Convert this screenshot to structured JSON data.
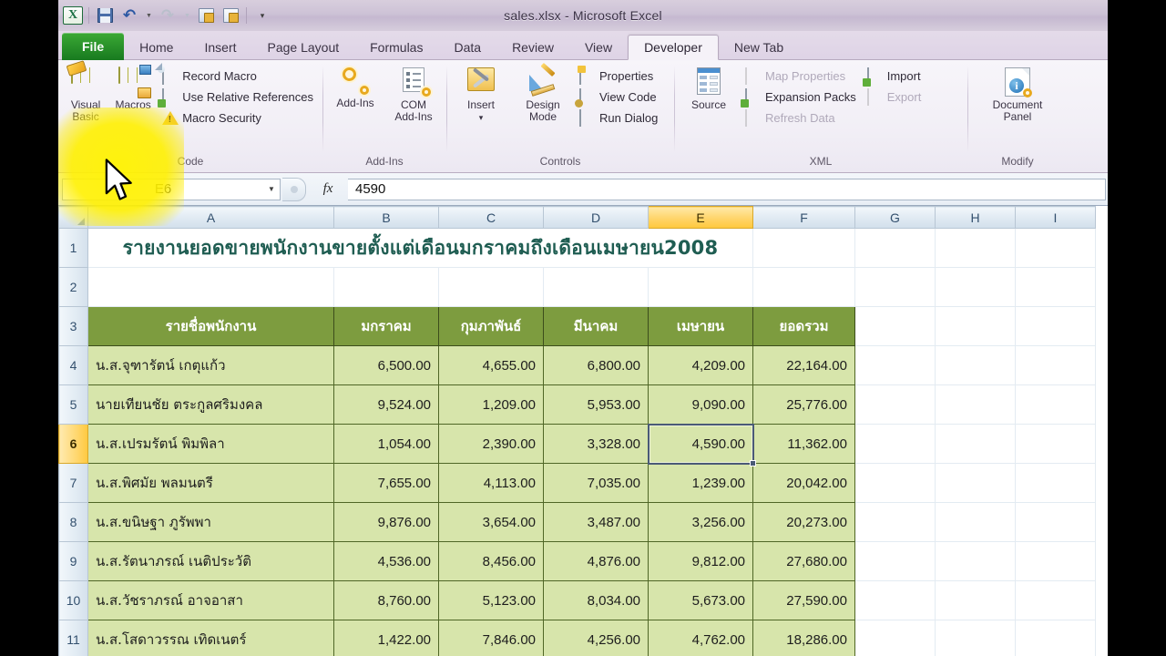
{
  "window": {
    "title": "sales.xlsx - Microsoft Excel"
  },
  "quick_access": {
    "items": [
      {
        "name": "excel-logo",
        "glyph": "X"
      },
      {
        "name": "save-button",
        "label": "Save"
      },
      {
        "name": "undo-button",
        "label": "Undo",
        "glyph": "↶"
      },
      {
        "name": "redo-button",
        "label": "Redo",
        "glyph": "↷"
      },
      {
        "name": "quick-print-button",
        "label": "Quick Print"
      },
      {
        "name": "print-preview-button",
        "label": "Print Preview"
      },
      {
        "name": "customize-qat-button",
        "label": "Customize Quick Access Toolbar",
        "glyph": "▾"
      }
    ]
  },
  "tabs": [
    {
      "label": "File",
      "active": false,
      "kind": "file"
    },
    {
      "label": "Home",
      "active": false
    },
    {
      "label": "Insert",
      "active": false
    },
    {
      "label": "Page Layout",
      "active": false
    },
    {
      "label": "Formulas",
      "active": false
    },
    {
      "label": "Data",
      "active": false
    },
    {
      "label": "Review",
      "active": false
    },
    {
      "label": "View",
      "active": false
    },
    {
      "label": "Developer",
      "active": true
    },
    {
      "label": "New Tab",
      "active": false
    }
  ],
  "ribbon": {
    "groups": [
      {
        "name": "Code",
        "big_buttons": [
          {
            "label": "Visual Basic",
            "line1": "Visual",
            "line2": "Basic",
            "icon": "visual-basic-icon"
          },
          {
            "label": "Macros",
            "line1": "Macros",
            "line2": "",
            "icon": "macros-icon"
          }
        ],
        "small_buttons": [
          {
            "label": "Record Macro",
            "icon": "record-macro-icon",
            "disabled": false
          },
          {
            "label": "Use Relative References",
            "icon": "relative-references-icon",
            "disabled": false
          },
          {
            "label": "Macro Security",
            "icon": "macro-security-icon",
            "disabled": false
          }
        ]
      },
      {
        "name": "Add-Ins",
        "big_buttons": [
          {
            "label": "Add-Ins",
            "line1": "Add-Ins",
            "line2": "",
            "icon": "add-ins-icon"
          },
          {
            "label": "COM Add-Ins",
            "line1": "COM",
            "line2": "Add-Ins",
            "icon": "com-add-ins-icon"
          }
        ],
        "small_buttons": []
      },
      {
        "name": "Controls",
        "big_buttons": [
          {
            "label": "Insert",
            "line1": "Insert",
            "line2": "▾",
            "icon": "insert-control-icon"
          },
          {
            "label": "Design Mode",
            "line1": "Design",
            "line2": "Mode",
            "icon": "design-mode-icon"
          }
        ],
        "small_buttons": [
          {
            "label": "Properties",
            "icon": "properties-icon",
            "disabled": false
          },
          {
            "label": "View Code",
            "icon": "view-code-icon",
            "disabled": false
          },
          {
            "label": "Run Dialog",
            "icon": "run-dialog-icon",
            "disabled": false
          }
        ]
      },
      {
        "name": "XML",
        "big_buttons": [
          {
            "label": "Source",
            "line1": "Source",
            "line2": "",
            "icon": "xml-source-icon"
          }
        ],
        "small_buttons": [
          {
            "label": "Map Properties",
            "icon": "map-properties-icon",
            "disabled": true
          },
          {
            "label": "Expansion Packs",
            "icon": "expansion-packs-icon",
            "disabled": false
          },
          {
            "label": "Refresh Data",
            "icon": "refresh-data-icon",
            "disabled": true
          },
          {
            "label": "Import",
            "icon": "import-icon",
            "disabled": false
          },
          {
            "label": "Export",
            "icon": "export-icon",
            "disabled": true
          }
        ]
      },
      {
        "name": "Modify",
        "big_buttons": [
          {
            "label": "Document Panel",
            "line1": "Document",
            "line2": "Panel",
            "icon": "document-panel-icon"
          }
        ],
        "small_buttons": []
      }
    ]
  },
  "formula_bar": {
    "name_box": "E6",
    "formula_value": "4590",
    "fx_label": "fx"
  },
  "grid": {
    "column_headers": [
      "A",
      "B",
      "C",
      "D",
      "E",
      "F",
      "G",
      "H",
      "I"
    ],
    "selected_column": "E",
    "selected_row": 6,
    "selected_cell": "E6",
    "row_numbers": [
      1,
      2,
      3,
      4,
      5,
      6,
      7,
      8,
      9,
      10,
      11
    ],
    "title": "รายงานยอดขายพนักงานขายตั้งแต่เดือนมกราคมถึงเดือนเมษายน2008",
    "table_headers": [
      "รายชื่อพนักงาน",
      "มกราคม",
      "กุมภาพันธ์",
      "มีนาคม",
      "เมษายน",
      "ยอดรวม"
    ],
    "rows": [
      {
        "row": 4,
        "name": "น.ส.จุฑารัตน์ เกตุแก้ว",
        "jan": "6,500.00",
        "feb": "4,655.00",
        "mar": "6,800.00",
        "apr": "4,209.00",
        "total": "22,164.00"
      },
      {
        "row": 5,
        "name": "นายเทียนชัย ตระกูลศริมงคล",
        "jan": "9,524.00",
        "feb": "1,209.00",
        "mar": "5,953.00",
        "apr": "9,090.00",
        "total": "25,776.00"
      },
      {
        "row": 6,
        "name": "น.ส.เปรมรัตน์ พิมพิลา",
        "jan": "1,054.00",
        "feb": "2,390.00",
        "mar": "3,328.00",
        "apr": "4,590.00",
        "total": "11,362.00"
      },
      {
        "row": 7,
        "name": "น.ส.พิศมัย พลมนตรี",
        "jan": "7,655.00",
        "feb": "4,113.00",
        "mar": "7,035.00",
        "apr": "1,239.00",
        "total": "20,042.00"
      },
      {
        "row": 8,
        "name": "น.ส.ขนิษฐา ภูรัพพา",
        "jan": "9,876.00",
        "feb": "3,654.00",
        "mar": "3,487.00",
        "apr": "3,256.00",
        "total": "20,273.00"
      },
      {
        "row": 9,
        "name": "น.ส.รัตนาภรณ์ เนติประวัติ",
        "jan": "4,536.00",
        "feb": "8,456.00",
        "mar": "4,876.00",
        "apr": "9,812.00",
        "total": "27,680.00"
      },
      {
        "row": 10,
        "name": "น.ส.วัชราภรณ์ อาจอาสา",
        "jan": "8,760.00",
        "feb": "5,123.00",
        "mar": "8,034.00",
        "apr": "5,673.00",
        "total": "27,590.00"
      },
      {
        "row": 11,
        "name": "น.ส.โสดาวรรณ เทิดเนตร์",
        "jan": "1,422.00",
        "feb": "7,846.00",
        "mar": "4,256.00",
        "apr": "4,762.00",
        "total": "18,286.00"
      }
    ]
  },
  "colors": {
    "header_green": "#7d9c3f",
    "cell_green": "#d7e5ab",
    "title_text": "#1f5d52",
    "selection_border": "#4a5a77",
    "selected_header": "#ffc93f",
    "highlight_blob": "#fff000"
  },
  "annotation": {
    "highlight_target": "Visual Basic",
    "cursor": "mouse-pointer"
  }
}
